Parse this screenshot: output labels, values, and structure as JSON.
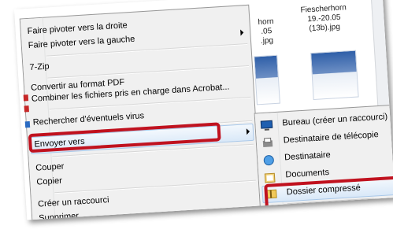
{
  "explorer": {
    "thumbs": [
      {
        "caption": "horn\n.05\n.jpg"
      },
      {
        "caption": "Fiescherhorn\n19.-20.05\n(13b).jpg"
      }
    ]
  },
  "context_menu": {
    "items": [
      {
        "label": "Faire pivoter vers la droite"
      },
      {
        "label": "Faire pivoter vers la gauche"
      },
      {
        "label": "7-Zip"
      },
      {
        "label": "Convertir au format PDF"
      },
      {
        "label": "Combiner les fichiers pris en charge dans Acrobat..."
      },
      {
        "label": "Rechercher d'éventuels virus"
      },
      {
        "label": "Envoyer vers"
      },
      {
        "label": "Couper"
      },
      {
        "label": "Copier"
      },
      {
        "label": "Créer un raccourci"
      },
      {
        "label": "Supprimer"
      }
    ]
  },
  "send_to_menu": {
    "items": [
      {
        "label": "Bureau (créer un raccourci)",
        "icon": "desktop-icon"
      },
      {
        "label": "Destinataire de télécopie",
        "icon": "fax-icon"
      },
      {
        "label": "Destinataire",
        "icon": "mail-recipient-icon"
      },
      {
        "label": "Documents",
        "icon": "documents-icon"
      },
      {
        "label": "Dossier compressé",
        "icon": "zip-folder-icon"
      }
    ]
  },
  "colors": {
    "callout": "#c0121f",
    "menu_bg": "#f0f0f0",
    "hover_border": "#a8c8ea"
  }
}
